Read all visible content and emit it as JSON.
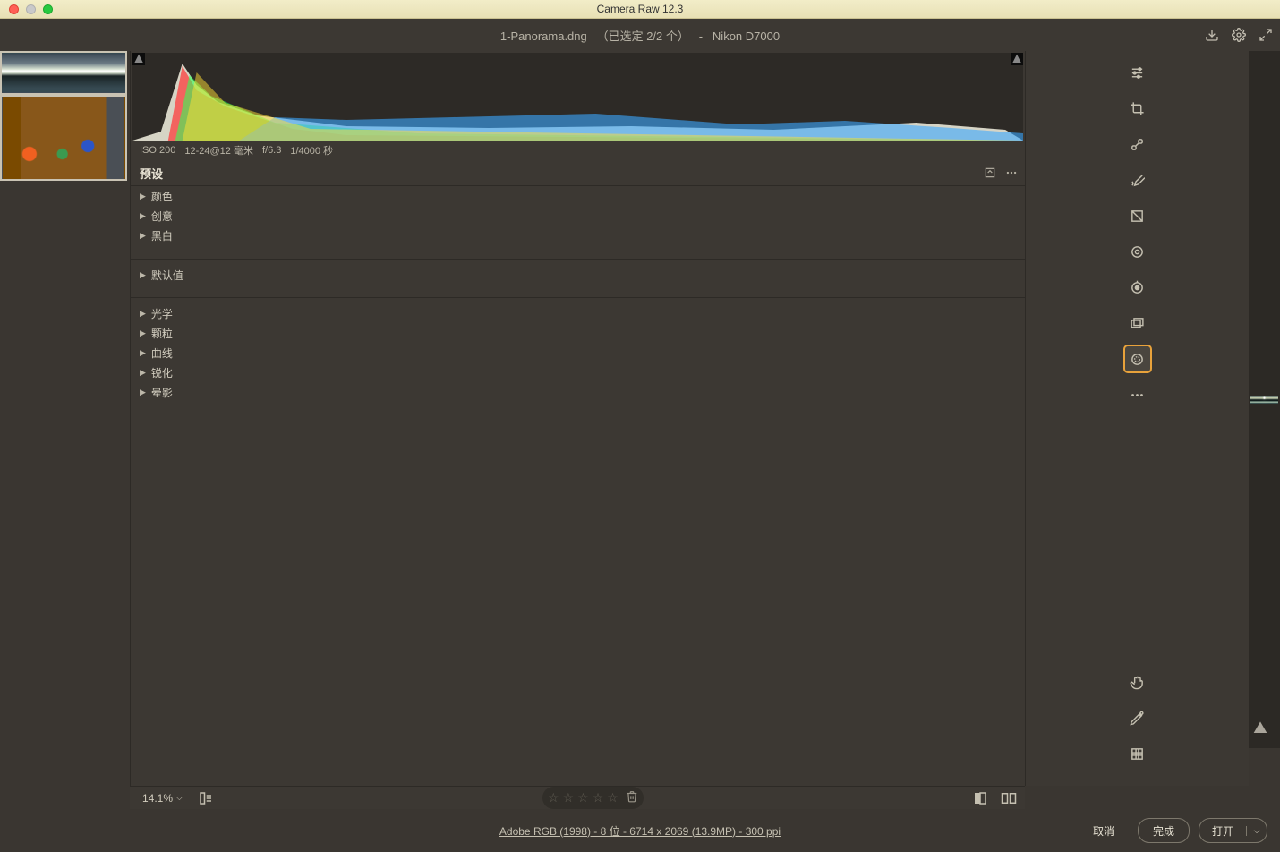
{
  "window": {
    "title": "Camera Raw 12.3"
  },
  "header": {
    "filename": "1-Panorama.dng",
    "selection": "（已选定 2/2 个）",
    "separator": "-",
    "camera": "Nikon D7000"
  },
  "histogram": {
    "iso": "ISO 200",
    "focal": "12-24@12 毫米",
    "aperture": "f/6.3",
    "shutter": "1/4000 秒"
  },
  "presets": {
    "title": "预设",
    "group1": [
      "颜色",
      "创意",
      "黑白"
    ],
    "defaults": "默认值",
    "group2": [
      "光学",
      "颗粒",
      "曲线",
      "锐化",
      "晕影"
    ]
  },
  "bottom": {
    "zoom": "14.1%"
  },
  "image_info": "Adobe RGB (1998) - 8 位 - 6714 x 2069 (13.9MP) - 300 ppi",
  "footer": {
    "cancel": "取消",
    "done": "完成",
    "open": "打开"
  },
  "tool_names": {
    "edit": "edit-sliders-icon",
    "crop": "crop-icon",
    "heal": "heal-brush-icon",
    "brush": "adjustment-brush-icon",
    "gradient": "gradient-icon",
    "radial": "radial-filter-icon",
    "redeye": "redeye-icon",
    "snapshots": "snapshots-icon",
    "presets": "presets-icon",
    "more": "more-icon",
    "hand": "hand-icon",
    "sampler": "color-sampler-icon",
    "grid": "grid-icon"
  }
}
